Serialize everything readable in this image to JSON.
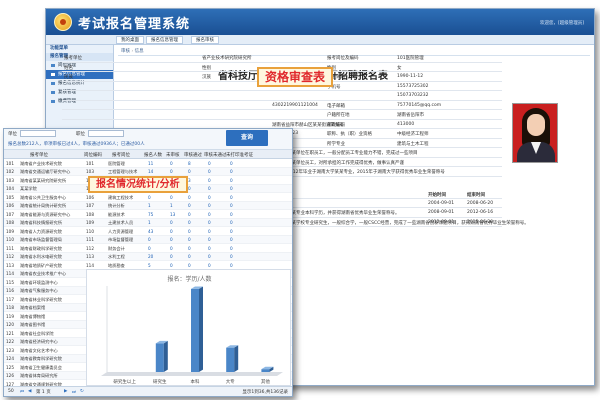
{
  "back_window": {
    "app_title": "考试报名管理系统",
    "user_info": "欢迎您，[超级管理员]",
    "tabs": [
      "我的桌面",
      "报名信息管理",
      "报名审核"
    ],
    "sidebar": {
      "header": "功能菜单",
      "group": "报名管理",
      "items": [
        "岗位管理",
        "报名信息管理",
        "报名信息统计",
        "复核管理",
        "缴费管理"
      ]
    },
    "breadcrumb": [
      "审核",
      "信息"
    ],
    "doc_title": "省科技厅所属事业单位公开招聘报名表",
    "form_rows": [
      {
        "l1": "报考单位",
        "v1": "省产业技术研究院研究所",
        "l2": "报考岗位及编码",
        "v2": "101医院管理"
      },
      {
        "l1": "姓名",
        "v1": "性别",
        "l2": "性别",
        "v2": "女"
      },
      {
        "l1": "民族",
        "v1": "汉族",
        "l2": "出生日期",
        "v2": "1990-11-12"
      },
      {
        "l1": "",
        "v1": "",
        "l2": "手机号",
        "v2": "15573725302"
      },
      {
        "l1": "",
        "v1": "",
        "l2": "",
        "v2": "15073703232"
      },
      {
        "l1": "",
        "v1": "4302219901121004",
        "l2": "电子邮箱",
        "v2": "75770145@qq.com"
      },
      {
        "l1": "",
        "v1": "",
        "l2": "户籍所在地",
        "v2": "湖南省岳阳市"
      },
      {
        "l1": "",
        "v1": "湖南省益阳市赫山区某某街道某某号",
        "l2": "邮政编码",
        "v2": "413000"
      },
      {
        "l1": "",
        "v1": "2016-11-23",
        "l2": "职称、执（职）业资格",
        "v2": "中级经济工程师"
      },
      {
        "l1": "",
        "v1": "大学",
        "l2": "所学专业",
        "v2": "建筑与土木工程"
      },
      {
        "l1": "",
        "v1": "某某单位在职员工，一般分配员工专业能力不错，完成过一些项目",
        "l2": "",
        "v2": ""
      },
      {
        "l1": "",
        "v1": "某某单位员工，对所承担的工作完成得优秀，做事认真严谨",
        "l2": "",
        "v2": ""
      },
      {
        "l1": "",
        "v1": "2012年毕业于湖南大学某某专业，2015年于湖南大学获得优秀毕业生荣誉称号",
        "l2": "",
        "v2": ""
      }
    ],
    "study_title": "学习经历",
    "work_title": "工作经历",
    "exp_head": {
      "desc": "",
      "start": "开始时间",
      "end": "结束时间"
    },
    "study_rows": [
      {
        "desc": "",
        "start": "2004-09-01",
        "end": "2008-06-20"
      },
      {
        "desc": "某某专业本科学历，并获得湖南省优秀毕业生荣誉称号。",
        "start": "2008-09-01",
        "end": "2012-06-16"
      },
      {
        "desc": "某某学校专业研究生，一般综合学，一般CSCC经营，完成了一些湖南省创新课题项目，获得湖南省优秀毕业生荣誉称号。",
        "start": "2012-09-01",
        "end": "2015-06-20"
      }
    ],
    "callout": "资格审查表"
  },
  "front_window": {
    "search_labels": [
      "单位",
      "职位"
    ],
    "search_button": "查询",
    "summary": "报名总数212人，单项审核已过4人，审核通过0936人；已通过00人",
    "columns": [
      "报考单位",
      "岗位编码",
      "报考岗位",
      "报名人数",
      "未审核",
      "审核通过",
      "审核未通过",
      "未打印准考证"
    ],
    "rows": [
      {
        "unit": "湖南省产业技术研究院",
        "code": "101",
        "job": "医院管理",
        "n": [
          11,
          0,
          8,
          0,
          0
        ]
      },
      {
        "unit": "湖南省交通运输厅研究中心",
        "code": "103",
        "job": "工程管理与技术",
        "n": [
          14,
          0,
          0,
          0,
          0
        ]
      },
      {
        "unit": "湖南省某某研究院研究所",
        "code": "104",
        "job": "农业技术人员",
        "n": [
          3,
          0,
          3,
          0,
          0
        ]
      },
      {
        "unit": "某某学院",
        "code": "105",
        "job": "公共卫生人员",
        "n": [
          7,
          0,
          0,
          0,
          0
        ]
      },
      {
        "unit": "湖南省公共卫生服务中心",
        "code": "106",
        "job": "建筑工程技术",
        "n": [
          0,
          0,
          0,
          0,
          0
        ]
      },
      {
        "unit": "湖南省统计局统计研究所",
        "code": "107",
        "job": "统计分析",
        "n": [
          1,
          1,
          0,
          0,
          0
        ]
      },
      {
        "unit": "湖南省能源与资源研究中心",
        "code": "108",
        "job": "能源技术",
        "n": [
          75,
          13,
          0,
          0,
          0
        ]
      },
      {
        "unit": "湖南省科技情报研究所",
        "code": "109",
        "job": "土建技术人员",
        "n": [
          1,
          0,
          0,
          0,
          0
        ]
      },
      {
        "unit": "湖南省人力资源研究院",
        "code": "110",
        "job": "人力资源管理",
        "n": [
          43,
          0,
          0,
          0,
          0
        ]
      },
      {
        "unit": "湖南省市场监督管理局",
        "code": "111",
        "job": "市场监督管理",
        "n": [
          0,
          0,
          0,
          0,
          0
        ]
      },
      {
        "unit": "湖南省财政科学研究院",
        "code": "112",
        "job": "财务会计",
        "n": [
          0,
          0,
          0,
          0,
          0
        ]
      },
      {
        "unit": "湖南省水利水电研究院",
        "code": "113",
        "job": "水利工程",
        "n": [
          20,
          0,
          0,
          0,
          0
        ]
      },
      {
        "unit": "湖南省地质矿产研究院",
        "code": "114",
        "job": "地质勘查",
        "n": [
          5,
          0,
          0,
          0,
          0
        ]
      },
      {
        "unit": "湖南省农业技术推广中心",
        "code": "115",
        "job": "农业技术",
        "n": [
          4,
          0,
          0,
          0,
          0
        ]
      },
      {
        "unit": "湖南省环境监测中心",
        "code": "116",
        "job": "环境监测",
        "n": [
          4,
          0,
          0,
          0,
          0
        ]
      },
      {
        "unit": "湖南省气象服务中心",
        "code": "117",
        "job": "气象服务",
        "n": [
          1,
          0,
          0,
          0,
          0
        ]
      },
      {
        "unit": "湖南省林业科学研究院",
        "code": "118",
        "job": "林业技术",
        "n": [
          0,
          0,
          0,
          0,
          0
        ]
      },
      {
        "unit": "湖南省档案馆",
        "code": "119",
        "job": "档案管理",
        "n": [
          0,
          0,
          0,
          0,
          0
        ]
      },
      {
        "unit": "湖南省博物馆",
        "code": "120",
        "job": "文物保护",
        "n": [
          0,
          0,
          0,
          0,
          0
        ]
      },
      {
        "unit": "湖南省图书馆",
        "code": "121",
        "job": "图书管理",
        "n": [
          0,
          0,
          0,
          0,
          0
        ]
      },
      {
        "unit": "湖南省社会科学院",
        "code": "122",
        "job": "社会科学研究",
        "n": [
          0,
          0,
          0,
          0,
          0
        ]
      },
      {
        "unit": "湖南省经济研究中心",
        "code": "123",
        "job": "经济研究",
        "n": [
          0,
          0,
          0,
          0,
          0
        ]
      },
      {
        "unit": "湖南省文化艺术中心",
        "code": "124",
        "job": "文化艺术",
        "n": [
          0,
          0,
          0,
          0,
          0
        ]
      },
      {
        "unit": "湖南省教育科学研究院",
        "code": "125",
        "job": "教育研究",
        "n": [
          0,
          0,
          0,
          0,
          0
        ]
      },
      {
        "unit": "湖南省卫生健康委员会",
        "code": "126",
        "job": "卫生管理",
        "n": [
          0,
          0,
          0,
          0,
          0
        ]
      },
      {
        "unit": "湖南省体育局研究所",
        "code": "127",
        "job": "体育科学",
        "n": [
          0,
          0,
          0,
          0,
          0
        ]
      },
      {
        "unit": "湖南省交通规划研究院",
        "code": "128",
        "job": "交通规划",
        "n": [
          0,
          0,
          0,
          0,
          0
        ]
      }
    ],
    "pager": {
      "size": "50",
      "page_label": "第 1 页",
      "info": "显示1到36,共136记录"
    },
    "callout": "报名情况统计/分析",
    "chart_data": {
      "type": "bar",
      "title": "报名：学历/人数",
      "categories": [
        "研究生以上",
        "研究生",
        "本科",
        "大专",
        "其他"
      ],
      "values": [
        0,
        20,
        58,
        17,
        2
      ],
      "ylim": [
        0,
        60
      ],
      "color": "#4a86c8"
    }
  }
}
